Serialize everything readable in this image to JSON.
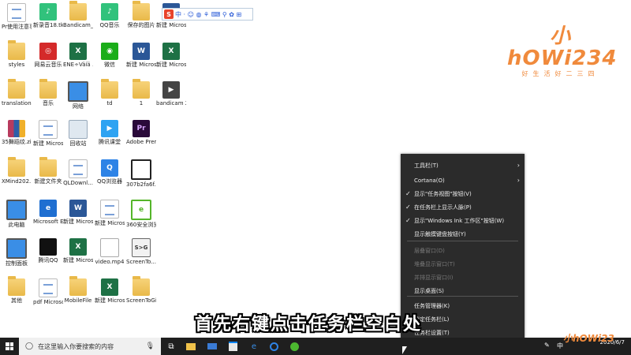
{
  "desktop": {
    "icons": [
      {
        "label": "Pr使用注意事项",
        "kind": "doc",
        "glyph": ""
      },
      {
        "label": "新录音18.tkm",
        "kind": "qqmusic",
        "glyph": "♪"
      },
      {
        "label": "Bandicam_...",
        "kind": "folder",
        "glyph": ""
      },
      {
        "label": "QQ音乐",
        "kind": "qqmusic",
        "glyph": "♪"
      },
      {
        "label": "保存的图片",
        "kind": "folder",
        "glyph": ""
      },
      {
        "label": "新建 Microsof...",
        "kind": "word",
        "glyph": "W"
      },
      {
        "label": "styles",
        "kind": "folder",
        "glyph": ""
      },
      {
        "label": "网易云音乐",
        "kind": "red",
        "glyph": "◎"
      },
      {
        "label": "ENE÷Väíä .xls",
        "kind": "excel",
        "glyph": "X"
      },
      {
        "label": "微信",
        "kind": "greenc",
        "glyph": "◉"
      },
      {
        "label": "新建 Microso...",
        "kind": "word",
        "glyph": "W"
      },
      {
        "label": "新建 Microso...",
        "kind": "excel",
        "glyph": "X"
      },
      {
        "label": "translations",
        "kind": "folder",
        "glyph": ""
      },
      {
        "label": "音乐",
        "kind": "folder",
        "glyph": ""
      },
      {
        "label": "网络",
        "kind": "monitor",
        "glyph": ""
      },
      {
        "label": "td",
        "kind": "folder",
        "glyph": ""
      },
      {
        "label": "1",
        "kind": "folder",
        "glyph": ""
      },
      {
        "label": "bandicam 2020-06-0...",
        "kind": "dark",
        "glyph": "▶"
      },
      {
        "label": "35舞蹈纹.zip",
        "kind": "zip",
        "glyph": ""
      },
      {
        "label": "新建 Microso...",
        "kind": "doc",
        "glyph": ""
      },
      {
        "label": "回收站",
        "kind": "recycle",
        "glyph": ""
      },
      {
        "label": "腾讯课堂",
        "kind": "tecent",
        "glyph": "▶"
      },
      {
        "label": "Adobe Premiere ...",
        "kind": "pr",
        "glyph": "Pr"
      },
      {
        "label": "XMind202...",
        "kind": "folder",
        "glyph": ""
      },
      {
        "label": "新建文件夹",
        "kind": "folder",
        "glyph": ""
      },
      {
        "label": "QLDownl...",
        "kind": "doc",
        "glyph": ""
      },
      {
        "label": "QQ浏览器",
        "kind": "bluec",
        "glyph": "Q"
      },
      {
        "label": "307b2fa6f...",
        "kind": "disc",
        "glyph": ""
      },
      {
        "label": "此电脑",
        "kind": "monitor",
        "glyph": ""
      },
      {
        "label": "Microsoft Edge",
        "kind": "edgec",
        "glyph": "e"
      },
      {
        "label": "新建 Microso...",
        "kind": "word",
        "glyph": "W"
      },
      {
        "label": "新建 Microso...",
        "kind": "doc",
        "glyph": ""
      },
      {
        "label": "360安全浏览器",
        "kind": "ie",
        "glyph": "e"
      },
      {
        "label": "控制面板",
        "kind": "monitor",
        "glyph": ""
      },
      {
        "label": "腾讯QQ",
        "kind": "penguin",
        "glyph": ""
      },
      {
        "label": "新建 Microsoft ...",
        "kind": "excel",
        "glyph": "X"
      },
      {
        "label": "video.mp4",
        "kind": "mp4",
        "glyph": ""
      },
      {
        "label": "ScreenTo...",
        "kind": "screen",
        "glyph": "S>G"
      },
      {
        "label": "其他",
        "kind": "folder",
        "glyph": ""
      },
      {
        "label": "pdf Microso...",
        "kind": "doc",
        "glyph": "e"
      },
      {
        "label": "MobileFile",
        "kind": "folder",
        "glyph": ""
      },
      {
        "label": "新建 Microsoft ...",
        "kind": "excel",
        "glyph": "X"
      },
      {
        "label": "ScreenToGif",
        "kind": "folder",
        "glyph": ""
      }
    ]
  },
  "ime": {
    "logo": "S",
    "items": "中 · ☺ ◍ ⚘ ⌨ ⚲ ✿ ⊞"
  },
  "watermark": {
    "main": "小hOWi234",
    "tagline": "好生活好二三四",
    "corner": "小hOWi23"
  },
  "context_menu": {
    "items": [
      {
        "label": "工具栏(T)",
        "checked": false,
        "submenu": true,
        "disabled": false
      },
      {
        "label": "Cortana(O)",
        "checked": false,
        "submenu": true,
        "disabled": false
      },
      {
        "label": "显示\"任务视图\"按钮(V)",
        "checked": true,
        "submenu": false,
        "disabled": false
      },
      {
        "label": "在任务栏上显示人脉(P)",
        "checked": true,
        "submenu": false,
        "disabled": false
      },
      {
        "label": "显示\"Windows Ink 工作区\"按钮(W)",
        "checked": true,
        "submenu": false,
        "disabled": false
      },
      {
        "label": "显示触摸键盘按钮(Y)",
        "checked": false,
        "submenu": false,
        "disabled": false
      },
      {
        "label": "层叠窗口(D)",
        "checked": false,
        "submenu": false,
        "disabled": true
      },
      {
        "label": "堆叠显示窗口(T)",
        "checked": false,
        "submenu": false,
        "disabled": true
      },
      {
        "label": "并排显示窗口(I)",
        "checked": false,
        "submenu": false,
        "disabled": true
      },
      {
        "label": "显示桌面(S)",
        "checked": false,
        "submenu": false,
        "disabled": false
      },
      {
        "label": "任务管理器(K)",
        "checked": false,
        "submenu": false,
        "disabled": false
      },
      {
        "label": "锁定任务栏(L)",
        "checked": true,
        "submenu": false,
        "disabled": false
      },
      {
        "label": "任务栏设置(T)",
        "checked": false,
        "submenu": false,
        "disabled": false
      }
    ],
    "check_glyph": "✓",
    "arrow_glyph": "›"
  },
  "subtitle": "首先右键点击任务栏空白处",
  "taskbar": {
    "search_placeholder": "在这里输入你要搜索的内容",
    "search_icon": "search-icon",
    "mic_icon": "microphone-icon",
    "apps": [
      "task-view-icon",
      "file-explorer-icon",
      "mail-icon",
      "store-icon",
      "edge-icon",
      "qq-browser-icon",
      "360-browser-icon"
    ],
    "tray_text": "中",
    "time_date": "2020/6/7"
  }
}
